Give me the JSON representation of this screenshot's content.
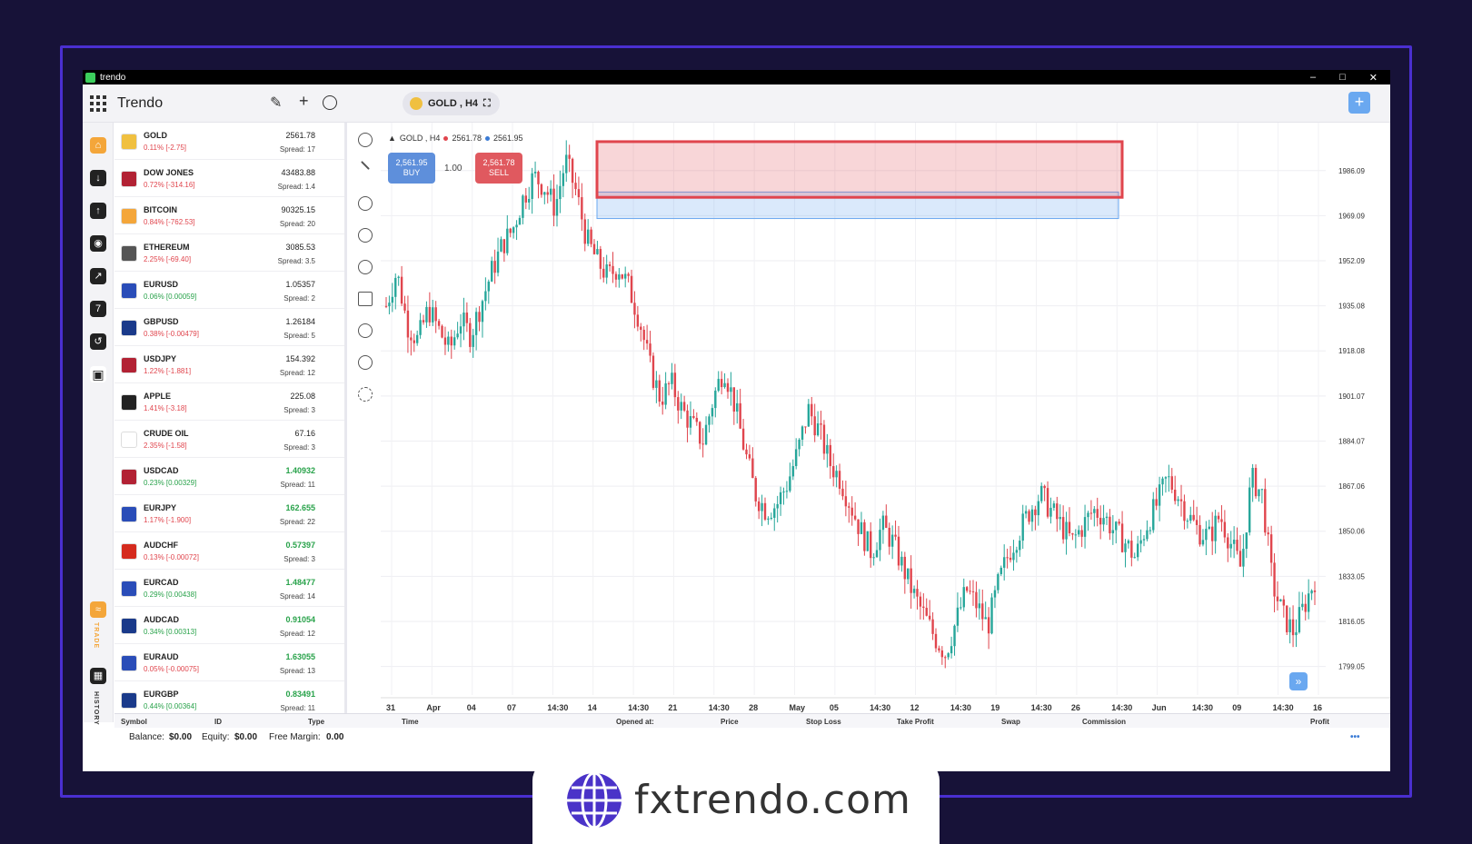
{
  "window": {
    "title": "trendo",
    "min": "–",
    "max": "□",
    "close": "✕"
  },
  "app": {
    "title": "Trendo",
    "pencil": "✎",
    "plus": "+",
    "chat": "◌",
    "symbol_chip": "GOLD , H4",
    "expand": "⛶",
    "add": "+"
  },
  "leftnav": {
    "trade_label": "TRADE",
    "history_label": "HISTORY"
  },
  "watchlist": [
    {
      "name": "GOLD",
      "change": "0.11% [-2.75]",
      "price": "2561.78",
      "spread": "Spread: 17",
      "dir": "neg",
      "bold": false,
      "color": "#f0c040"
    },
    {
      "name": "DOW JONES",
      "change": "0.72% [-314.16]",
      "price": "43483.88",
      "spread": "Spread: 1.4",
      "dir": "neg",
      "bold": false,
      "color": "#b22234"
    },
    {
      "name": "BITCOIN",
      "change": "0.84% [-762.53]",
      "price": "90325.15",
      "spread": "Spread: 20",
      "dir": "neg",
      "bold": false,
      "color": "#f4a63a"
    },
    {
      "name": "ETHEREUM",
      "change": "2.25% [-69.40]",
      "price": "3085.53",
      "spread": "Spread: 3.5",
      "dir": "neg",
      "bold": false,
      "color": "#555555"
    },
    {
      "name": "EURUSD",
      "change": "0.06% [0.00059]",
      "price": "1.05357",
      "spread": "Spread: 2",
      "dir": "pos",
      "bold": false,
      "color": "#2a4db8"
    },
    {
      "name": "GBPUSD",
      "change": "0.38% [-0.00479]",
      "price": "1.26184",
      "spread": "Spread: 5",
      "dir": "neg",
      "bold": false,
      "color": "#1a3a8a"
    },
    {
      "name": "USDJPY",
      "change": "1.22% [-1.881]",
      "price": "154.392",
      "spread": "Spread: 12",
      "dir": "neg",
      "bold": false,
      "color": "#b22234"
    },
    {
      "name": "APPLE",
      "change": "1.41% [-3.18]",
      "price": "225.08",
      "spread": "Spread: 3",
      "dir": "neg",
      "bold": false,
      "color": "#222222"
    },
    {
      "name": "CRUDE OIL",
      "change": "2.35% [-1.58]",
      "price": "67.16",
      "spread": "Spread: 3",
      "dir": "neg",
      "bold": false,
      "color": "#ffffff"
    },
    {
      "name": "USDCAD",
      "change": "0.23% [0.00329]",
      "price": "1.40932",
      "spread": "Spread: 11",
      "dir": "pos",
      "bold": true,
      "color": "#b22234"
    },
    {
      "name": "EURJPY",
      "change": "1.17% [-1.900]",
      "price": "162.655",
      "spread": "Spread: 22",
      "dir": "neg",
      "bold": true,
      "color": "#2a4db8"
    },
    {
      "name": "AUDCHF",
      "change": "0.13% [-0.00072]",
      "price": "0.57397",
      "spread": "Spread: 3",
      "dir": "neg",
      "bold": true,
      "color": "#d52b1e"
    },
    {
      "name": "EURCAD",
      "change": "0.29% [0.00438]",
      "price": "1.48477",
      "spread": "Spread: 14",
      "dir": "pos",
      "bold": true,
      "color": "#2a4db8"
    },
    {
      "name": "AUDCAD",
      "change": "0.34% [0.00313]",
      "price": "0.91054",
      "spread": "Spread: 12",
      "dir": "pos",
      "bold": true,
      "color": "#1a3a8a"
    },
    {
      "name": "EURAUD",
      "change": "0.05% [-0.00075]",
      "price": "1.63055",
      "spread": "Spread: 13",
      "dir": "neg",
      "bold": true,
      "color": "#2a4db8"
    },
    {
      "name": "EURGBP",
      "change": "0.44% [0.00364]",
      "price": "0.83491",
      "spread": "Spread: 11",
      "dir": "pos",
      "bold": true,
      "color": "#1a3a8a"
    }
  ],
  "chart": {
    "legend_symbol": "GOLD , H4",
    "legend_sell": "2561.78",
    "legend_buy": "2561.95",
    "buy_price": "2,561.95",
    "buy_label": "BUY",
    "sell_price": "2,561.78",
    "sell_label": "SELL",
    "lot": "1.00",
    "ff": "»"
  },
  "chart_data": {
    "type": "candlestick",
    "y_ticks": [
      "1986.09",
      "1969.09",
      "1952.09",
      "1935.08",
      "1918.08",
      "1901.07",
      "1884.07",
      "1867.06",
      "1850.06",
      "1833.05",
      "1816.05",
      "1799.05"
    ],
    "x_ticks": [
      "31",
      "Apr",
      "04",
      "07",
      "14:30",
      "14",
      "14:30",
      "21",
      "14:30",
      "28",
      "May",
      "05",
      "14:30",
      "12",
      "14:30",
      "19",
      "14:30",
      "26",
      "14:30",
      "Jun",
      "14:30",
      "09",
      "14:30",
      "16"
    ],
    "ylim": [
      1790,
      1998
    ],
    "grid": true,
    "colors": {
      "up": "#26a69a",
      "down": "#e0454d",
      "supply_zone": "#e0454d",
      "demand_zone": "#6aa8f0"
    },
    "path": [
      1935,
      1948,
      1928,
      1922,
      1934,
      1926,
      1918,
      1930,
      1924,
      1936,
      1948,
      1958,
      1964,
      1976,
      1984,
      1980,
      1972,
      1990,
      1978,
      1960,
      1952,
      1946,
      1950,
      1942,
      1930,
      1912,
      1900,
      1906,
      1896,
      1890,
      1884,
      1900,
      1912,
      1898,
      1880,
      1864,
      1858,
      1860,
      1868,
      1880,
      1896,
      1888,
      1876,
      1870,
      1860,
      1850,
      1842,
      1852,
      1846,
      1836,
      1826,
      1818,
      1810,
      1804,
      1816,
      1828,
      1822,
      1814,
      1830,
      1842,
      1850,
      1858,
      1864,
      1858,
      1852,
      1846,
      1852,
      1858,
      1856,
      1850,
      1846,
      1840,
      1852,
      1860,
      1870,
      1864,
      1856,
      1850,
      1848,
      1856,
      1846,
      1836,
      1870,
      1864,
      1830,
      1818,
      1812,
      1822,
      1832
    ]
  },
  "orders": {
    "symbol": "Symbol",
    "id": "ID",
    "type": "Type",
    "time": "Time",
    "opened": "Opened at:",
    "price": "Price",
    "sl": "Stop Loss",
    "tp": "Take Profit",
    "swap": "Swap",
    "commission": "Commission",
    "profit": "Profit"
  },
  "footer": {
    "balance_label": "Balance:",
    "balance": "$0.00",
    "equity_label": "Equity:",
    "equity": "$0.00",
    "margin_label": "Free Margin:",
    "margin": "0.00",
    "more": "•••"
  },
  "badge": {
    "domain": "fxtrendo.com"
  }
}
